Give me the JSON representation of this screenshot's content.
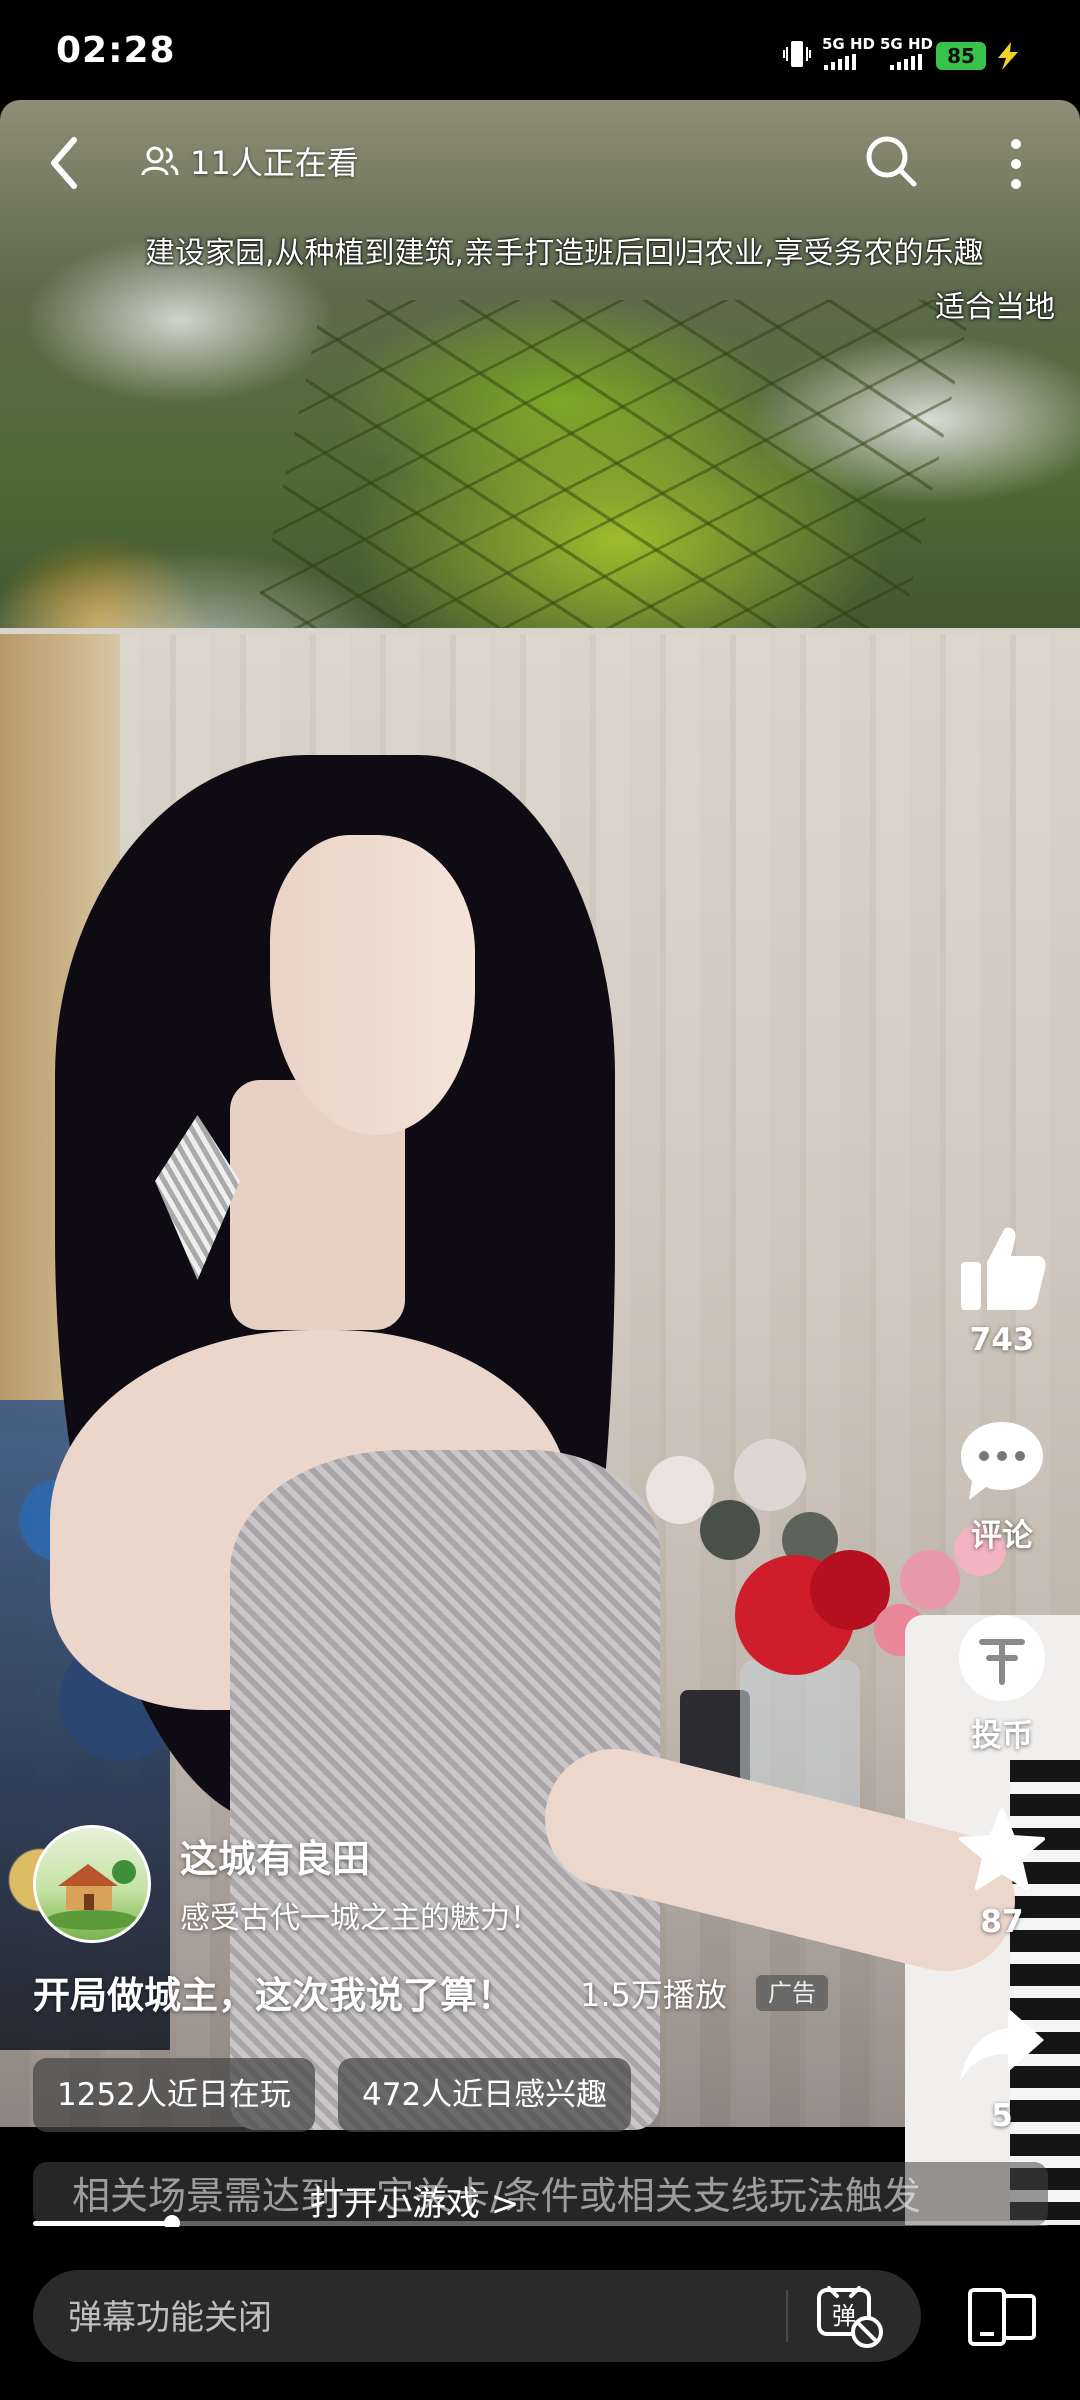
{
  "status_bar": {
    "time": "02:28",
    "network_1": "5G HD",
    "network_2": "5G HD",
    "battery": "85",
    "battery_color": "#3ac14a"
  },
  "top_bar": {
    "back_icon": "chevron-left-icon",
    "viewers": "11人正在看",
    "search_icon": "search-icon",
    "more_icon": "more-vertical-icon"
  },
  "video": {
    "subtitle_line1": "建设家园,从种植到建筑,亲手打造班后回归农业,享受务农的乐趣",
    "subtitle_line2": "适合当地"
  },
  "actions": {
    "like": {
      "icon": "thumbs-up-icon",
      "count": "743"
    },
    "comment": {
      "icon": "comment-bubble-icon",
      "label": "评论"
    },
    "coin": {
      "icon": "coin-icon",
      "label": "投币"
    },
    "favorite": {
      "icon": "star-icon",
      "count": "87"
    },
    "share": {
      "icon": "share-arrow-icon",
      "count": "5"
    }
  },
  "ad": {
    "account_name": "这城有良田",
    "account_desc": "感受古代一城之主的魅力！",
    "title": "开局做城主，这次我说了算！",
    "plays": "1.5万播放",
    "badge": "广告",
    "stat_players": "1252人近日在玩",
    "stat_interest": "472人近日感兴趣",
    "banner_caption": "相关场景需达到一定关卡/条件或相关支线玩法触发",
    "banner_label": "打开小游戏 >"
  },
  "progress": {
    "fraction": 0.137
  },
  "bottom_bar": {
    "danmaku_placeholder": "弹幕功能关闭",
    "danmaku_icon": "danmaku-off-icon",
    "rotate_icon": "screen-rotate-icon"
  }
}
